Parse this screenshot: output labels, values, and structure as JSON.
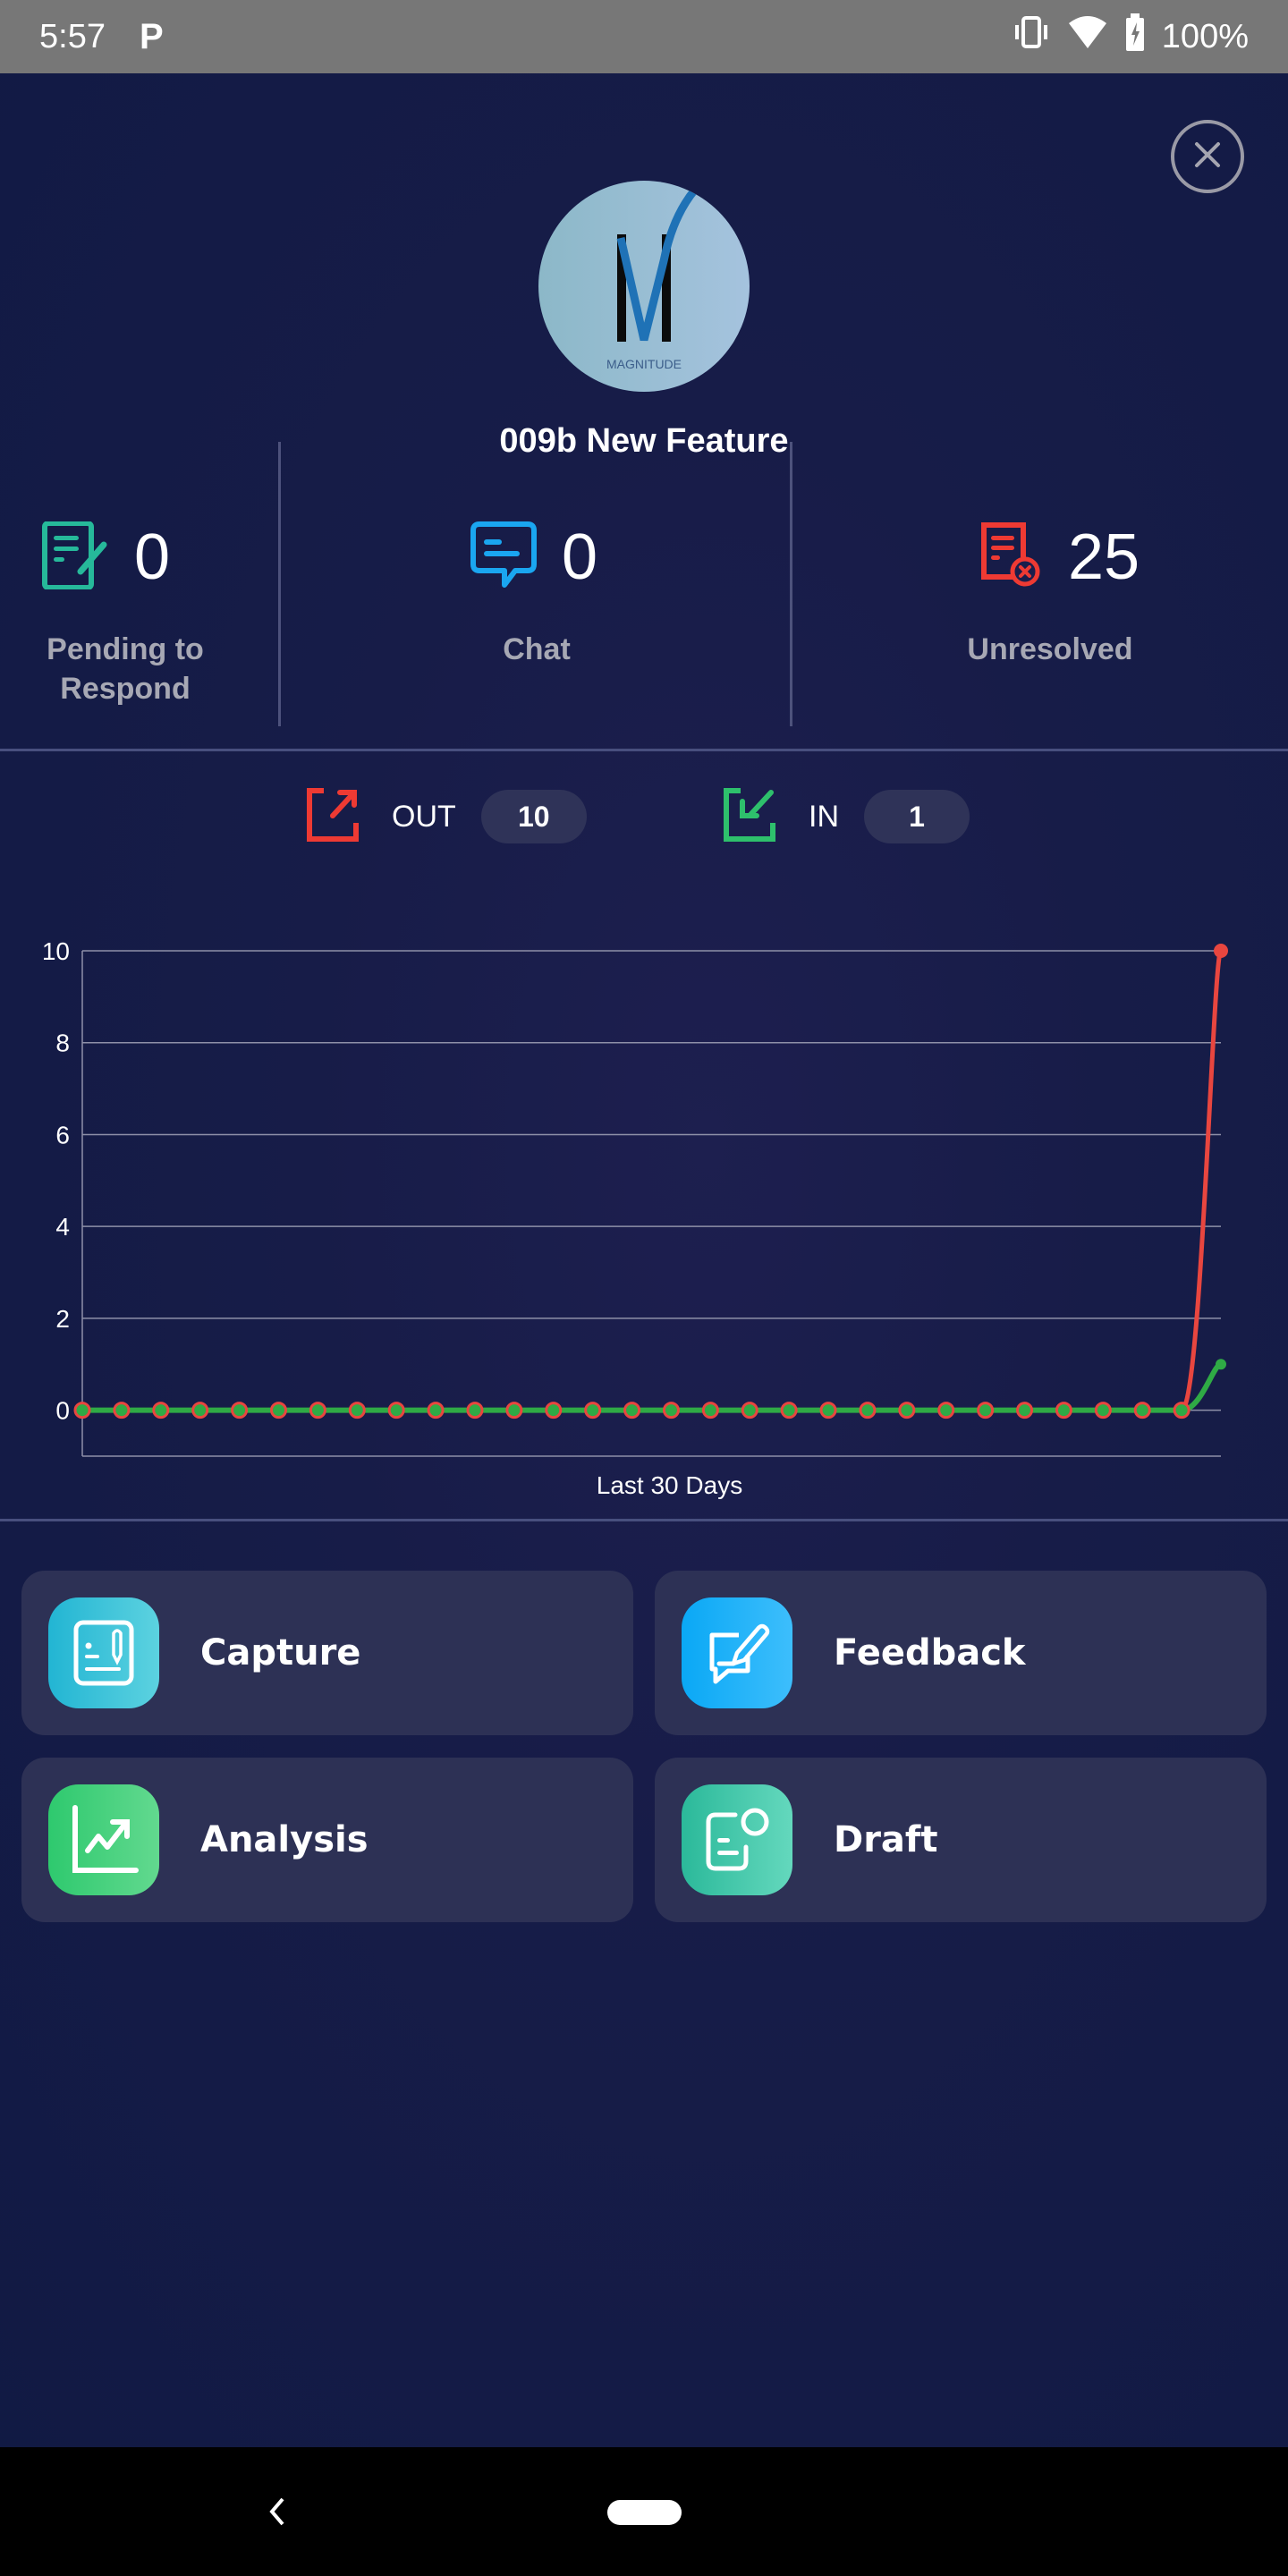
{
  "status_bar": {
    "time": "5:57",
    "notification_icon": "parking-p-icon",
    "battery": "100%",
    "icons": [
      "vibrate-icon",
      "wifi-icon",
      "battery-charging-icon"
    ]
  },
  "header": {
    "close_icon": "close-icon",
    "avatar_text": "MAGNITUDE",
    "title": "009b New Feature"
  },
  "stats": [
    {
      "icon": "pending-respond-icon",
      "value": "0",
      "label": "Pending to Respond",
      "color": "#26b99a"
    },
    {
      "icon": "chat-icon",
      "value": "0",
      "label": "Chat",
      "color": "#1aa6f0"
    },
    {
      "icon": "unresolved-icon",
      "value": "25",
      "label": "Unresolved",
      "color": "#ee3a33"
    }
  ],
  "io": {
    "out": {
      "label": "OUT",
      "value": "10",
      "color": "#ee3a33"
    },
    "in": {
      "label": "IN",
      "value": "1",
      "color": "#2ec06c"
    }
  },
  "chart_data": {
    "type": "line",
    "title": "",
    "xlabel": "Last 30 Days",
    "ylabel": "",
    "ylim": [
      -1,
      10
    ],
    "yticks": [
      0,
      2,
      4,
      6,
      8,
      10
    ],
    "grid": true,
    "x": [
      1,
      2,
      3,
      4,
      5,
      6,
      7,
      8,
      9,
      10,
      11,
      12,
      13,
      14,
      15,
      16,
      17,
      18,
      19,
      20,
      21,
      22,
      23,
      24,
      25,
      26,
      27,
      28,
      29,
      30
    ],
    "series": [
      {
        "name": "OUT",
        "color": "#e8463f",
        "values": [
          0,
          0,
          0,
          0,
          0,
          0,
          0,
          0,
          0,
          0,
          0,
          0,
          0,
          0,
          0,
          0,
          0,
          0,
          0,
          0,
          0,
          0,
          0,
          0,
          0,
          0,
          0,
          0,
          0,
          10
        ]
      },
      {
        "name": "IN",
        "color": "#2faa45",
        "values": [
          0,
          0,
          0,
          0,
          0,
          0,
          0,
          0,
          0,
          0,
          0,
          0,
          0,
          0,
          0,
          0,
          0,
          0,
          0,
          0,
          0,
          0,
          0,
          0,
          0,
          0,
          0,
          0,
          0,
          1
        ]
      }
    ]
  },
  "actions": [
    {
      "label": "Capture",
      "icon": "capture-icon",
      "gradient": [
        "#22b5d3",
        "#5cd2e0"
      ]
    },
    {
      "label": "Feedback",
      "icon": "feedback-icon",
      "gradient": [
        "#0aa8f5",
        "#3dbefc"
      ]
    },
    {
      "label": "Analysis",
      "icon": "analysis-icon",
      "gradient": [
        "#2ec96e",
        "#62d98f"
      ]
    },
    {
      "label": "Draft",
      "icon": "draft-icon",
      "gradient": [
        "#2bb99a",
        "#64d8bd"
      ]
    }
  ],
  "nav": {
    "back_icon": "back-icon",
    "home_icon": "home-pill-icon"
  }
}
